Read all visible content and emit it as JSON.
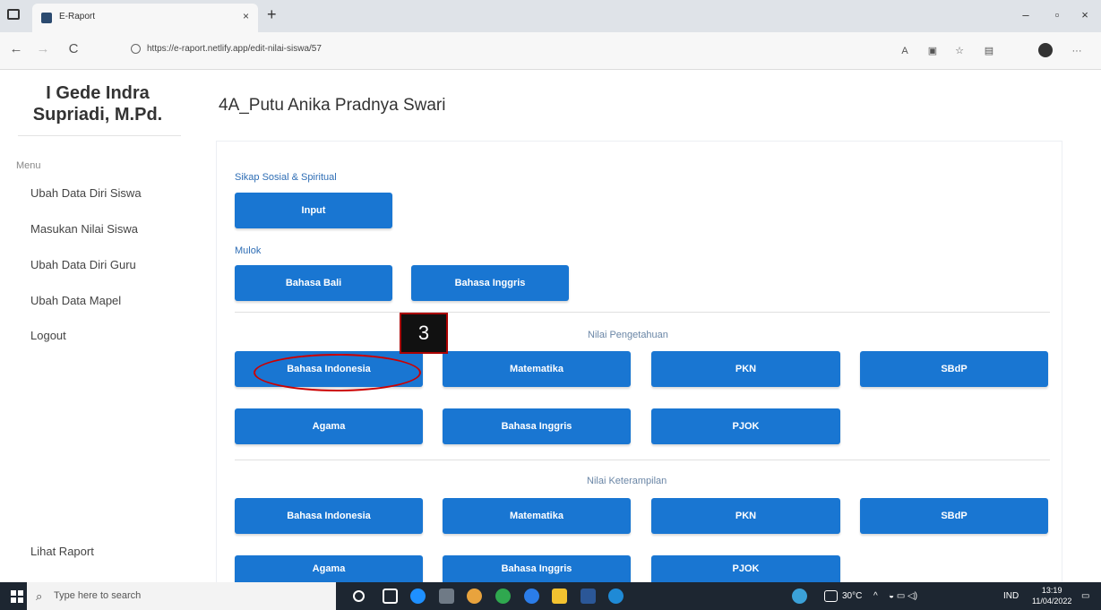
{
  "browser": {
    "tab_title": "E-Raport",
    "tab_close": "×",
    "new_tab": "+",
    "url": "https://e-raport.netlify.app/edit-nilai-siswa/57",
    "win_minimize": "–",
    "win_maximize": "▫",
    "win_close": "×",
    "back": "←",
    "forward": "→",
    "refresh": "C"
  },
  "sidebar": {
    "teacher_name_line1": "I Gede Indra",
    "teacher_name_line2": "Supriadi, M.Pd.",
    "menu_heading": "Menu",
    "items": [
      {
        "label": "Ubah Data Diri Siswa"
      },
      {
        "label": "Masukan Nilai Siswa"
      },
      {
        "label": "Ubah Data Diri Guru"
      },
      {
        "label": "Ubah Data Mapel"
      },
      {
        "label": "Logout"
      }
    ],
    "lihat_raport": "Lihat Raport"
  },
  "main": {
    "title": "4A_Putu Anika Pradnya Swari",
    "sikap_label": "Sikap Sosial & Spiritual",
    "sikap_button": "Input",
    "mulok_label": "Mulok",
    "mulok_buttons": [
      "Bahasa Bali",
      "Bahasa Inggris"
    ],
    "pengetahuan_label": "Nilai Pengetahuan",
    "pengetahuan_buttons": [
      "Bahasa Indonesia",
      "Matematika",
      "PKN",
      "SBdP",
      "Agama",
      "Bahasa Inggris",
      "PJOK"
    ],
    "keterampilan_label": "Nilai Keterampilan",
    "keterampilan_buttons": [
      "Bahasa Indonesia",
      "Matematika",
      "PKN",
      "SBdP",
      "Agama",
      "Bahasa Inggris",
      "PJOK"
    ]
  },
  "annotation": {
    "step_number": "3",
    "color": "#cc0000"
  },
  "taskbar": {
    "search_placeholder": "Type here to search",
    "weather": "30°C",
    "language": "IND",
    "time": "13:19",
    "date": "11/04/2022"
  }
}
